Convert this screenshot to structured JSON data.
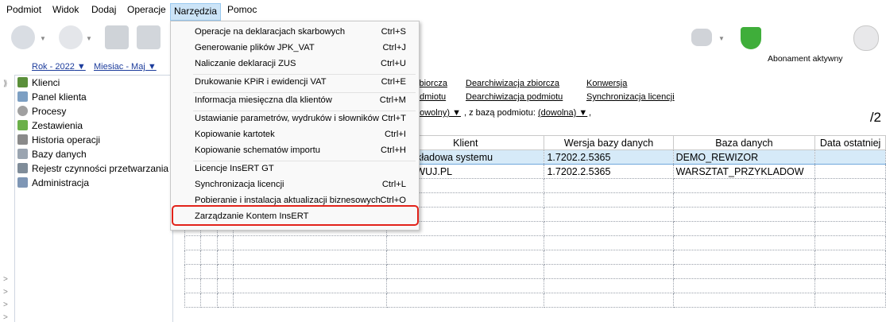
{
  "menubar": [
    "Podmiot",
    "Widok",
    "Dodaj",
    "Operacje",
    "Narzędzia",
    "Pomoc"
  ],
  "toolbar": {
    "subscription": "Abonament aktywny"
  },
  "period": {
    "year": "Rok - 2022",
    "month": "Miesiac - Maj"
  },
  "sidebar": {
    "items": [
      "Klienci",
      "Panel klienta",
      "Procesy",
      "Zestawienia",
      "Historia operacji",
      "Bazy danych",
      "Rejestr czynności przetwarzania",
      "Administracja"
    ]
  },
  "content": {
    "links_row1": [
      "zbiorcza",
      "Dearchiwizacja zbiorcza",
      "Konwersja"
    ],
    "links_row2": [
      "odmiotu",
      "Dearchiwizacja podmiotu",
      "Synchronizacja licencji"
    ],
    "filter": "dowolny)",
    "filter_mid": ", z bazą podmiotu:",
    "filter_val": "(dowolna)",
    "filter_end": ",",
    "page_counter": "/2"
  },
  "grid": {
    "columns": [
      "Klient",
      "Wersja bazy danych",
      "Baza danych",
      "Data ostatniej"
    ],
    "rows": [
      [
        "a przykładowa systemu",
        "1.7202.2.5365",
        "DEMO_REWIZOR",
        ""
      ],
      [
        "EZERWUJ.PL",
        "1.7202.2.5365",
        "WARSZTAT_PRZYKLADOW",
        ""
      ]
    ]
  },
  "menu": {
    "items": [
      {
        "label": "Operacje na deklaracjach skarbowych",
        "shortcut": "Ctrl+S"
      },
      {
        "label": "Generowanie plików JPK_VAT",
        "shortcut": "Ctrl+J"
      },
      {
        "label": "Naliczanie deklaracji ZUS",
        "shortcut": "Ctrl+U"
      },
      {
        "label": "Drukowanie KPiR i ewidencji VAT",
        "shortcut": "Ctrl+E"
      },
      {
        "label": "Informacja miesięczna dla klientów",
        "shortcut": "Ctrl+M"
      },
      {
        "label": "Ustawianie parametrów, wydruków i słowników",
        "shortcut": "Ctrl+T"
      },
      {
        "label": "Kopiowanie kartotek",
        "shortcut": "Ctrl+I"
      },
      {
        "label": "Kopiowanie schematów importu",
        "shortcut": "Ctrl+H"
      },
      {
        "label": "Licencje InsERT GT",
        "shortcut": ""
      },
      {
        "label": "Synchronizacja licencji",
        "shortcut": "Ctrl+L"
      },
      {
        "label": "Pobieranie i instalacja aktualizacji biznesowych",
        "shortcut": "Ctrl+O"
      },
      {
        "label": "Zarządzanie Kontem InsERT",
        "shortcut": ""
      }
    ]
  }
}
